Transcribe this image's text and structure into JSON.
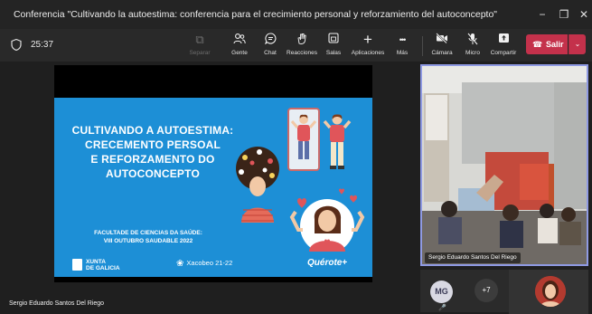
{
  "window": {
    "title": "Conferencia \"Cultivando la autoestima: conferencia para el crecimiento personal y reforzamiento del autoconcepto\"",
    "minimize": "−",
    "maximize": "❐",
    "close": "✕"
  },
  "toolbar": {
    "timer": "25:37",
    "tools": [
      {
        "label": "Separar",
        "icon": "separate-icon",
        "glyph": "⧉",
        "enabled": false
      },
      {
        "label": "Gente",
        "icon": "people-icon",
        "glyph": "👥",
        "enabled": true
      },
      {
        "label": "Chat",
        "icon": "chat-icon",
        "glyph": "💬",
        "enabled": true
      },
      {
        "label": "Reacciones",
        "icon": "reactions-icon",
        "glyph": "✋",
        "enabled": true
      },
      {
        "label": "Salas",
        "icon": "rooms-icon",
        "glyph": "▣",
        "enabled": true
      },
      {
        "label": "Aplicaciones",
        "icon": "plus-icon",
        "glyph": "+",
        "enabled": true
      },
      {
        "label": "Más",
        "icon": "more-icon",
        "glyph": "•••",
        "enabled": true
      },
      {
        "label": "Cámara",
        "icon": "camera-off-icon",
        "glyph": "▶",
        "enabled": true
      },
      {
        "label": "Micro",
        "icon": "mic-off-icon",
        "glyph": "🎤",
        "enabled": true
      },
      {
        "label": "Compartir",
        "icon": "share-icon",
        "glyph": "⇪",
        "enabled": true
      }
    ],
    "leave_label": "Salir",
    "leave_color": "#c4314b"
  },
  "slide": {
    "title_lines": [
      "CULTIVANDO A AUTOESTIMA:",
      "CRECEMENTO PERSOAL",
      "E REFORZAMENTO DO",
      "AUTOCONCEPTO"
    ],
    "faculty_lines": [
      "FACULTADE DE CIENCIAS DA SAÚDE:",
      "VIII OUTUBRO SAUDABLE 2022"
    ],
    "xunta_lines": [
      "XUNTA",
      "DE GALICIA"
    ],
    "xacobeo": "Xacobeo 21-22",
    "querote": "Quérote",
    "querote_plus": "+",
    "background_color": "#1d8fd6"
  },
  "presenter_name": "Sergio Eduardo Santos Del Riego",
  "video_tile": {
    "name": "Sergio Eduardo Santos Del Riego",
    "accent_border": "#8f9ae3"
  },
  "participants": {
    "avatar_initials": "MG",
    "more_label": "+7"
  }
}
